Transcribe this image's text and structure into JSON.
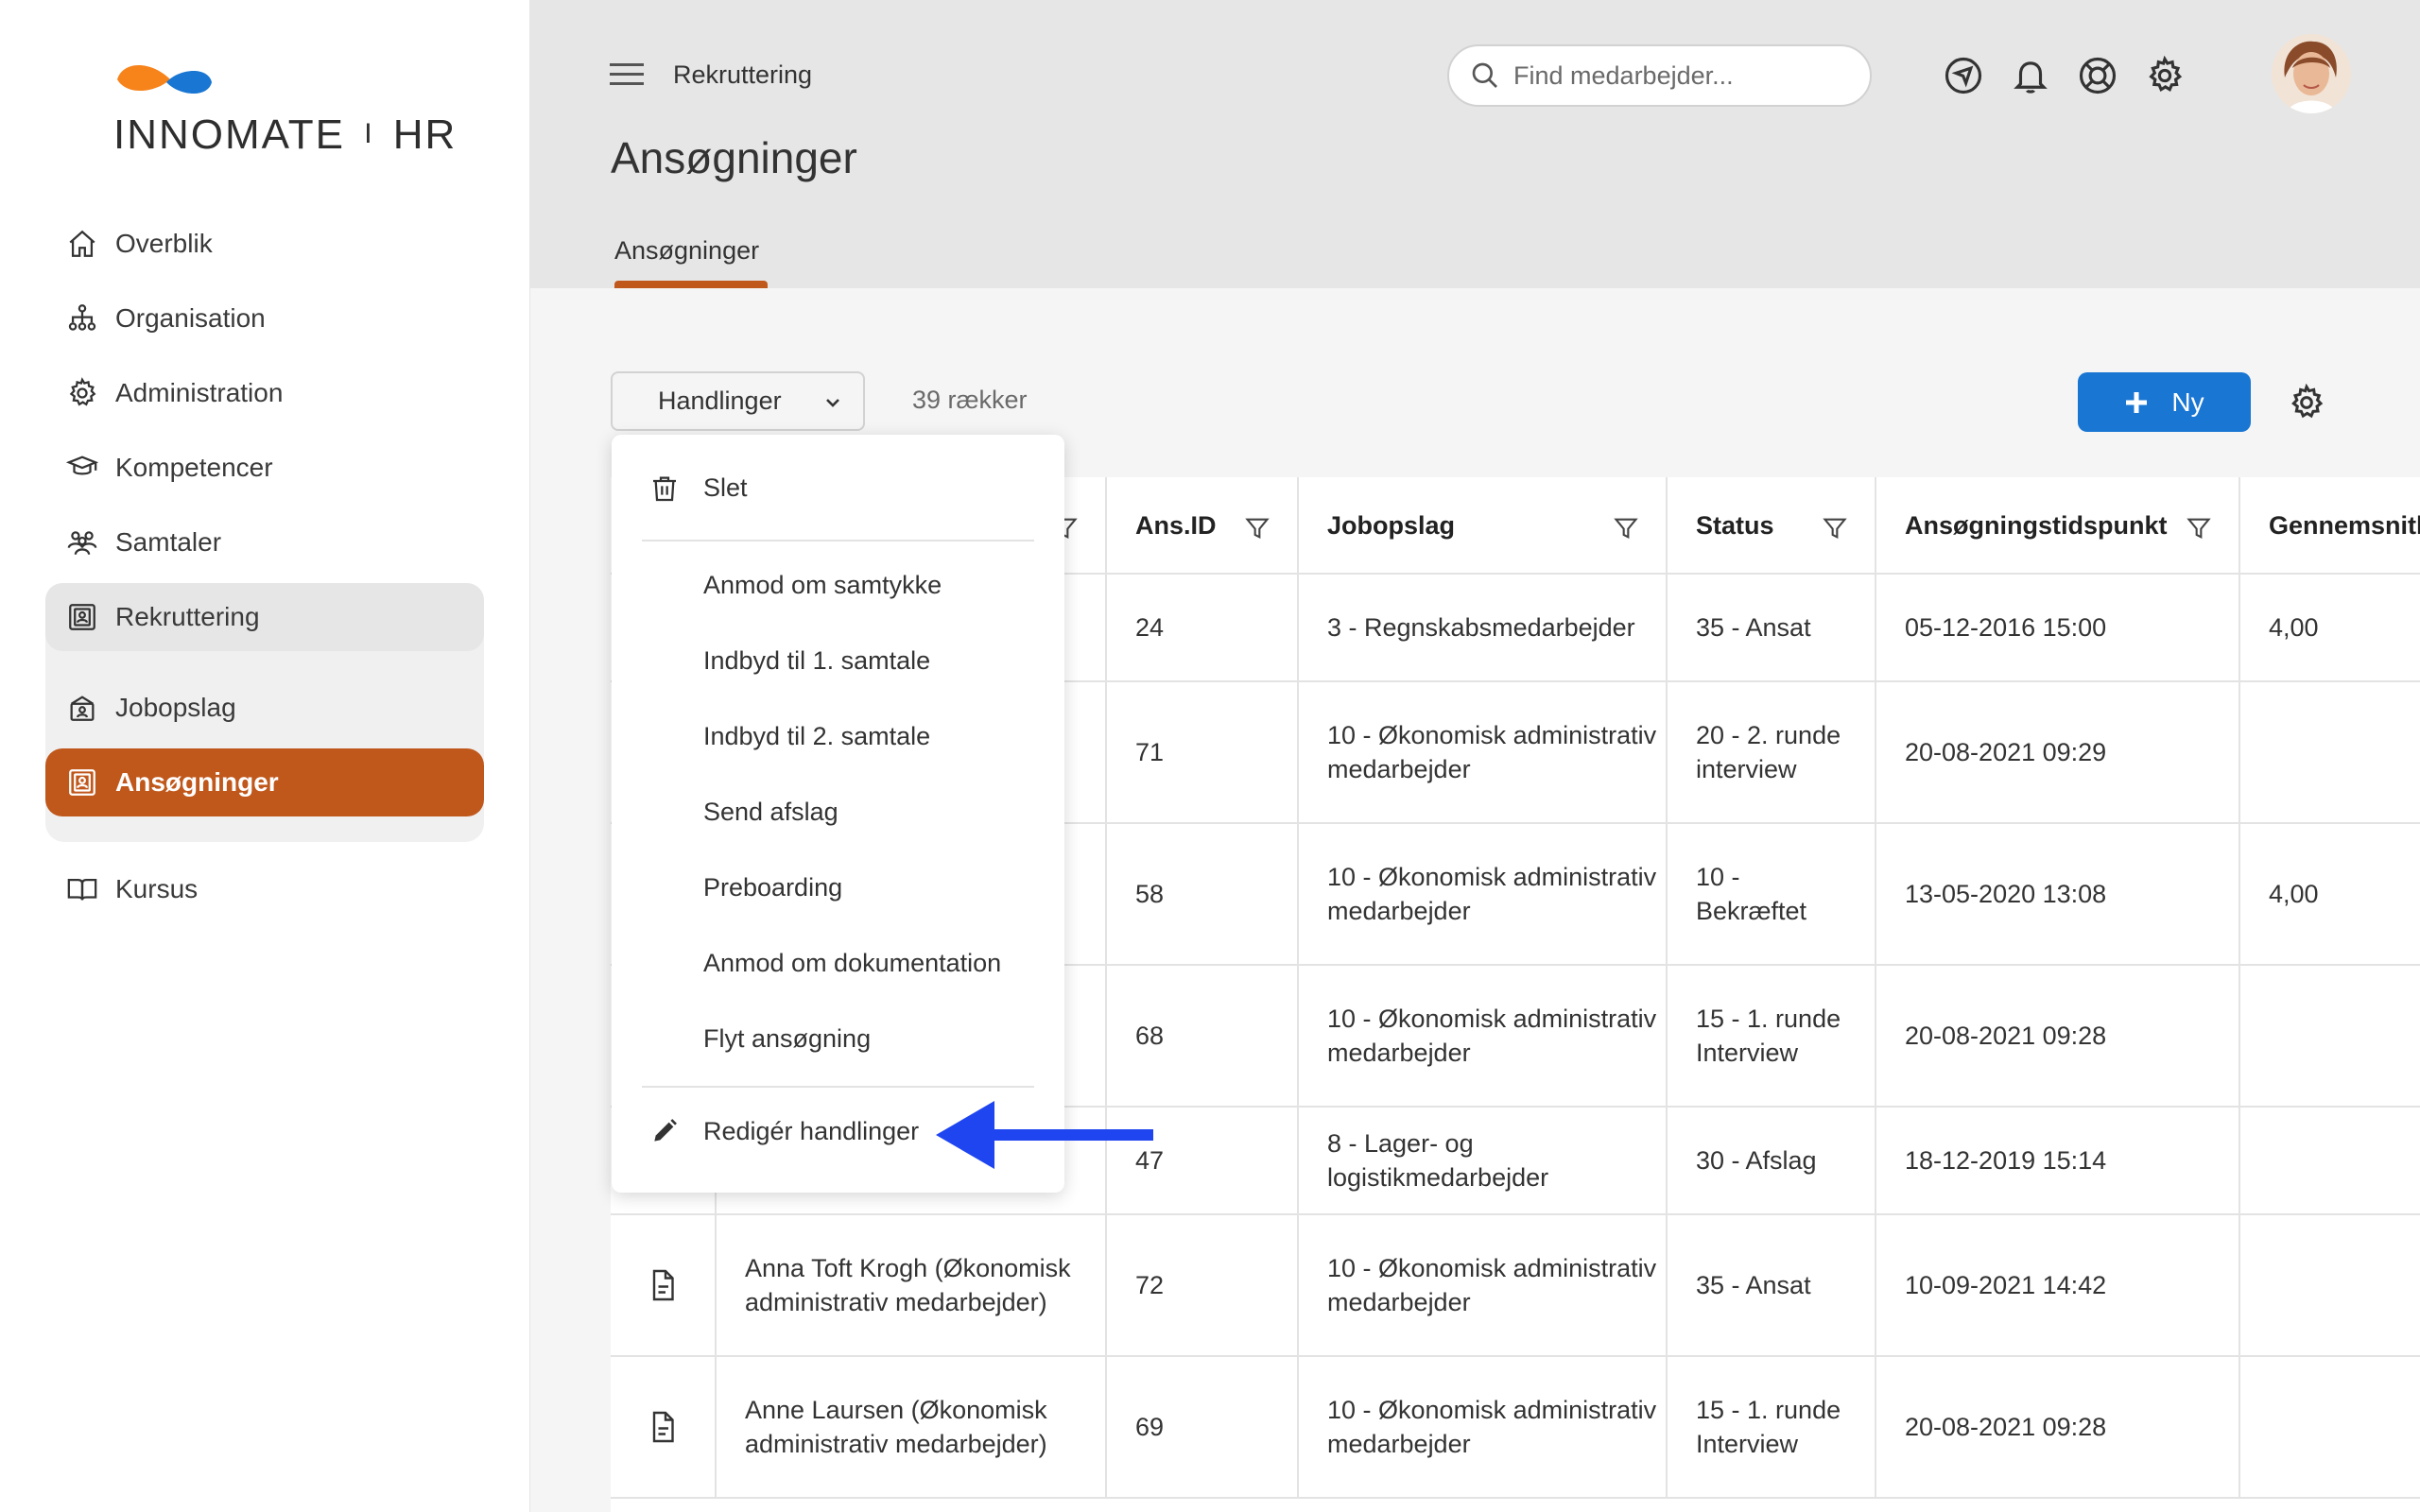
{
  "brand": {
    "name_light": "INNOMATE",
    "separator": "I",
    "name_bold": "HR",
    "colors": {
      "orange": "#F7831B",
      "blue": "#1976D2",
      "accent": "#C0571B"
    }
  },
  "sidebar": {
    "items": [
      {
        "label": "Overblik",
        "icon": "home-icon"
      },
      {
        "label": "Organisation",
        "icon": "org-chart-icon"
      },
      {
        "label": "Administration",
        "icon": "gear-icon"
      },
      {
        "label": "Kompetencer",
        "icon": "graduation-cap-icon"
      }
    ],
    "samtaler": {
      "label": "Samtaler",
      "icon": "people-icon"
    },
    "group": {
      "label": "Rekruttering",
      "icon": "badge-icon",
      "children": [
        {
          "label": "Jobopslag",
          "icon": "job-icon"
        },
        {
          "label": "Ansøgninger",
          "icon": "application-icon"
        }
      ]
    },
    "kursus": {
      "label": "Kursus",
      "icon": "book-icon"
    }
  },
  "header": {
    "breadcrumb": "Rekruttering",
    "search_placeholder": "Find medarbejder...",
    "page_title": "Ansøgninger",
    "tab": "Ansøgninger"
  },
  "toolbar": {
    "actions_label": "Handlinger",
    "row_count": "39 rækker",
    "new_label": "Ny"
  },
  "menu": {
    "delete": "Slet",
    "items": [
      "Anmod om samtykke",
      "Indbyd til 1. samtale",
      "Indbyd til 2. samtale",
      "Send afslag",
      "Preboarding",
      "Anmod om dokumentation",
      "Flyt ansøgning"
    ],
    "edit": "Redigér handlinger"
  },
  "table": {
    "columns": [
      "Ans.ID",
      "Jobopslag",
      "Status",
      "Ansøgningstidspunkt",
      "Gennemsnitlig"
    ],
    "rows": [
      {
        "name": "",
        "id": "24",
        "job": "3 - Regnskabsmedarbejder",
        "status": "35 - Ansat",
        "time": "05-12-2016 15:00",
        "avg": "4,00"
      },
      {
        "name": "",
        "id": "71",
        "job": "10 - Økonomisk administrativ medarbejder",
        "status": "20 - 2. runde interview",
        "time": "20-08-2021 09:29",
        "avg": ""
      },
      {
        "name": "",
        "id": "58",
        "job": "10 - Økonomisk administrativ medarbejder",
        "status": "10 - Bekræftet",
        "time": "13-05-2020 13:08",
        "avg": "4,00"
      },
      {
        "name": "",
        "id": "68",
        "job": "10 - Økonomisk administrativ medarbejder",
        "status": "15 - 1. runde Interview",
        "time": "20-08-2021 09:28",
        "avg": ""
      },
      {
        "name": "",
        "id": "47",
        "job": "8 - Lager- og logistikmedarbejder",
        "status": "30 - Afslag",
        "time": "18-12-2019 15:14",
        "avg": ""
      },
      {
        "name": "Anna Toft Krogh (Økonomisk administrativ medarbejder)",
        "id": "72",
        "job": "10 - Økonomisk administrativ medarbejder",
        "status": "35 - Ansat",
        "time": "10-09-2021 14:42",
        "avg": ""
      },
      {
        "name": "Anne Laursen (Økonomisk administrativ medarbejder)",
        "id": "69",
        "job": "10 - Økonomisk administrativ medarbejder",
        "status": "15 - 1. runde Interview",
        "time": "20-08-2021 09:28",
        "avg": ""
      }
    ]
  }
}
